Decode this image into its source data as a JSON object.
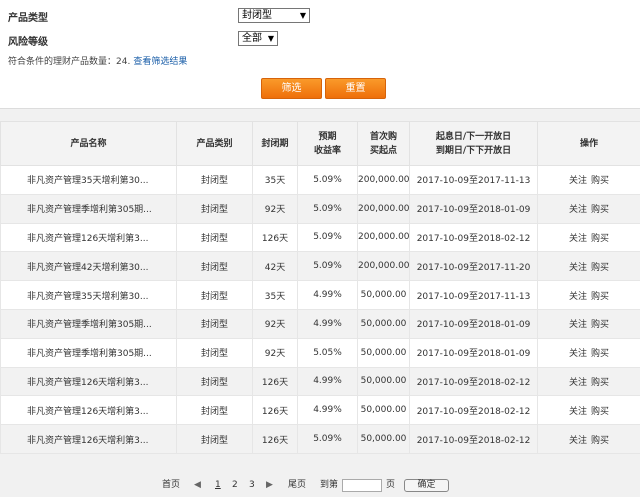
{
  "filters": {
    "product_type_label": "产品类型",
    "product_type_value": "封闭型",
    "risk_level_label": "风险等级",
    "risk_level_value": "全部",
    "count_prefix": "符合条件的理财产品数量：",
    "count": "24.",
    "view_results_link": "查看筛选结果",
    "filter_button": "筛选",
    "reset_button": "重置"
  },
  "table": {
    "headers": {
      "name": "产品名称",
      "category": "产品类别",
      "period": "封闭期",
      "yield_line1": "预期",
      "yield_line2": "收益率",
      "min_line1": "首次购",
      "min_line2": "买起点",
      "date_line1": "起息日/下一开放日",
      "date_line2": "到期日/下下开放日",
      "ops": "操作"
    },
    "rows": [
      {
        "name": "非凡资产管理35天增利第30...",
        "category": "封闭型",
        "period": "35天",
        "yield": "5.09%",
        "min": "200,000.00",
        "dates": "2017-10-09至2017-11-13",
        "follow": "关注",
        "buy": "购买"
      },
      {
        "name": "非凡资产管理季增利第305期...",
        "category": "封闭型",
        "period": "92天",
        "yield": "5.09%",
        "min": "200,000.00",
        "dates": "2017-10-09至2018-01-09",
        "follow": "关注",
        "buy": "购买"
      },
      {
        "name": "非凡资产管理126天增利第3...",
        "category": "封闭型",
        "period": "126天",
        "yield": "5.09%",
        "min": "200,000.00",
        "dates": "2017-10-09至2018-02-12",
        "follow": "关注",
        "buy": "购买"
      },
      {
        "name": "非凡资产管理42天增利第30...",
        "category": "封闭型",
        "period": "42天",
        "yield": "5.09%",
        "min": "200,000.00",
        "dates": "2017-10-09至2017-11-20",
        "follow": "关注",
        "buy": "购买"
      },
      {
        "name": "非凡资产管理35天增利第30...",
        "category": "封闭型",
        "period": "35天",
        "yield": "4.99%",
        "min": "50,000.00",
        "dates": "2017-10-09至2017-11-13",
        "follow": "关注",
        "buy": "购买"
      },
      {
        "name": "非凡资产管理季增利第305期...",
        "category": "封闭型",
        "period": "92天",
        "yield": "4.99%",
        "min": "50,000.00",
        "dates": "2017-10-09至2018-01-09",
        "follow": "关注",
        "buy": "购买"
      },
      {
        "name": "非凡资产管理季增利第305期...",
        "category": "封闭型",
        "period": "92天",
        "yield": "5.05%",
        "min": "50,000.00",
        "dates": "2017-10-09至2018-01-09",
        "follow": "关注",
        "buy": "购买"
      },
      {
        "name": "非凡资产管理126天增利第3...",
        "category": "封闭型",
        "period": "126天",
        "yield": "4.99%",
        "min": "50,000.00",
        "dates": "2017-10-09至2018-02-12",
        "follow": "关注",
        "buy": "购买"
      },
      {
        "name": "非凡资产管理126天增利第3...",
        "category": "封闭型",
        "period": "126天",
        "yield": "4.99%",
        "min": "50,000.00",
        "dates": "2017-10-09至2018-02-12",
        "follow": "关注",
        "buy": "购买"
      },
      {
        "name": "非凡资产管理126天增利第3...",
        "category": "封闭型",
        "period": "126天",
        "yield": "5.09%",
        "min": "50,000.00",
        "dates": "2017-10-09至2018-02-12",
        "follow": "关注",
        "buy": "购买"
      }
    ]
  },
  "pager": {
    "first": "首页",
    "pages": [
      "1",
      "2",
      "3"
    ],
    "last": "尾页",
    "goto_prefix": "到第",
    "goto_suffix": "页",
    "confirm": "确定",
    "prev_icon": "triangle-left-icon",
    "next_icon": "triangle-right-icon"
  },
  "colors": {
    "accent": "#f28a1c",
    "link": "#1a5ea8"
  }
}
